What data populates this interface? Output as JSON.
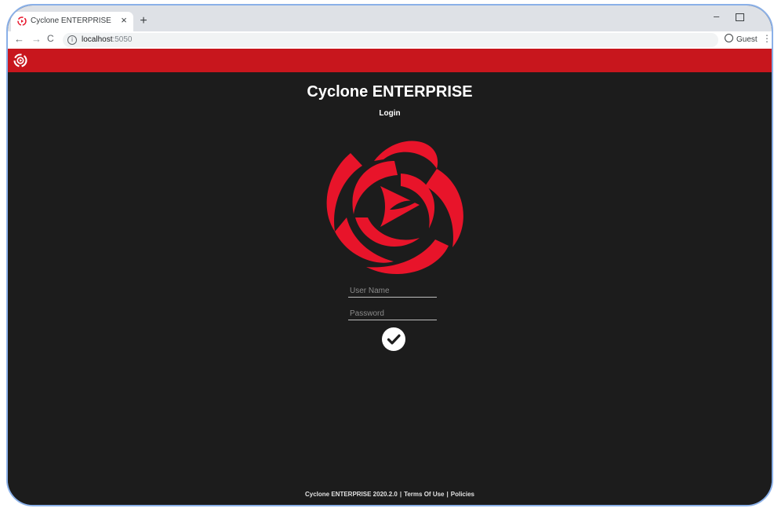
{
  "browser": {
    "tab_title": "Cyclone ENTERPRISE",
    "tab_close": "×",
    "new_tab": "+",
    "url_host": "localhost",
    "url_port": ":5050",
    "profile_label": "Guest",
    "minimize_glyph": "–",
    "icons": {
      "back": "arrow-left",
      "forward": "arrow-right",
      "reload": "reload",
      "info": "info",
      "profile": "person",
      "menu": "three-dots"
    }
  },
  "app": {
    "brand_color": "#c8161d",
    "logo_color": "#e8142a",
    "title": "Cyclone ENTERPRISE",
    "subtitle": "Login"
  },
  "login": {
    "username_placeholder": "User Name",
    "password_placeholder": "Password",
    "submit_icon": "check-circle"
  },
  "footer": {
    "version": "Cyclone ENTERPRISE 2020.2.0",
    "separator": "|",
    "terms": "Terms Of Use",
    "policies": "Policies"
  }
}
